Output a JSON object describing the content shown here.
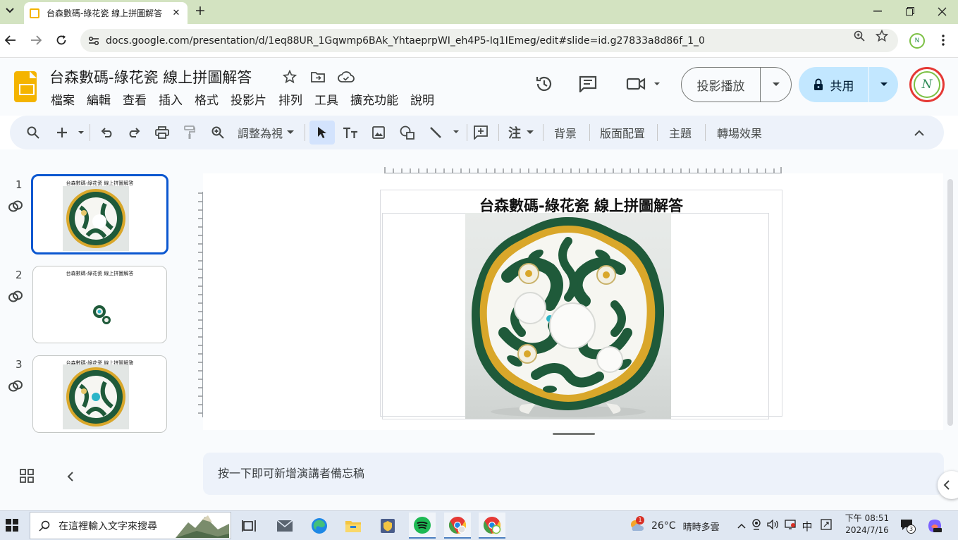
{
  "browser": {
    "tab_title": "台森數碼-綠花瓷 線上拼圖解答",
    "url": "docs.google.com/presentation/d/1eq88UR_1Gqwmp6BAk_YhtaeprpWI_eh4P5-Iq1IEmeg/edit#slide=id.g27833a8d86f_1_0",
    "profile_initials": "N"
  },
  "header": {
    "doc_title": "台森數碼-綠花瓷 線上拼圖解答",
    "menu": [
      "檔案",
      "編輯",
      "查看",
      "插入",
      "格式",
      "投影片",
      "排列",
      "工具",
      "擴充功能",
      "說明"
    ],
    "present_label": "投影播放",
    "share_label": "共用",
    "avatar_initials": "N"
  },
  "toolbar": {
    "zoom_label": "調整為視",
    "background_label": "背景",
    "layout_label": "版面配置",
    "theme_label": "主題",
    "transition_label": "轉場效果"
  },
  "filmstrip": {
    "slides": [
      {
        "num": "1",
        "title": "台森數碼-綠花瓷 線上拼圖解答"
      },
      {
        "num": "2",
        "title": "台森數碼-綠花瓷 線上拼圖解答"
      },
      {
        "num": "3",
        "title": "台森數碼-綠花瓷 線上拼圖解答"
      }
    ]
  },
  "slide": {
    "title": "台森數碼-綠花瓷 線上拼圖解答"
  },
  "notes": {
    "placeholder": "按一下即可新增演講者備忘稿"
  },
  "taskbar": {
    "search_placeholder": "在這裡輸入文字來搜尋",
    "weather_badge": "1",
    "temperature": "26°C",
    "weather_text": "晴時多雲",
    "ime": "中",
    "time": "下午 08:51",
    "date": "2024/7/16",
    "notification_count": "3"
  },
  "colors": {
    "tabstrip": "#d3e3c1",
    "accent_blue": "#0b57d0",
    "share_bg": "#c2e7ff",
    "slides_yellow": "#f4b400",
    "plate_green": "#1f5a3a",
    "plate_gold": "#d9a72a"
  }
}
